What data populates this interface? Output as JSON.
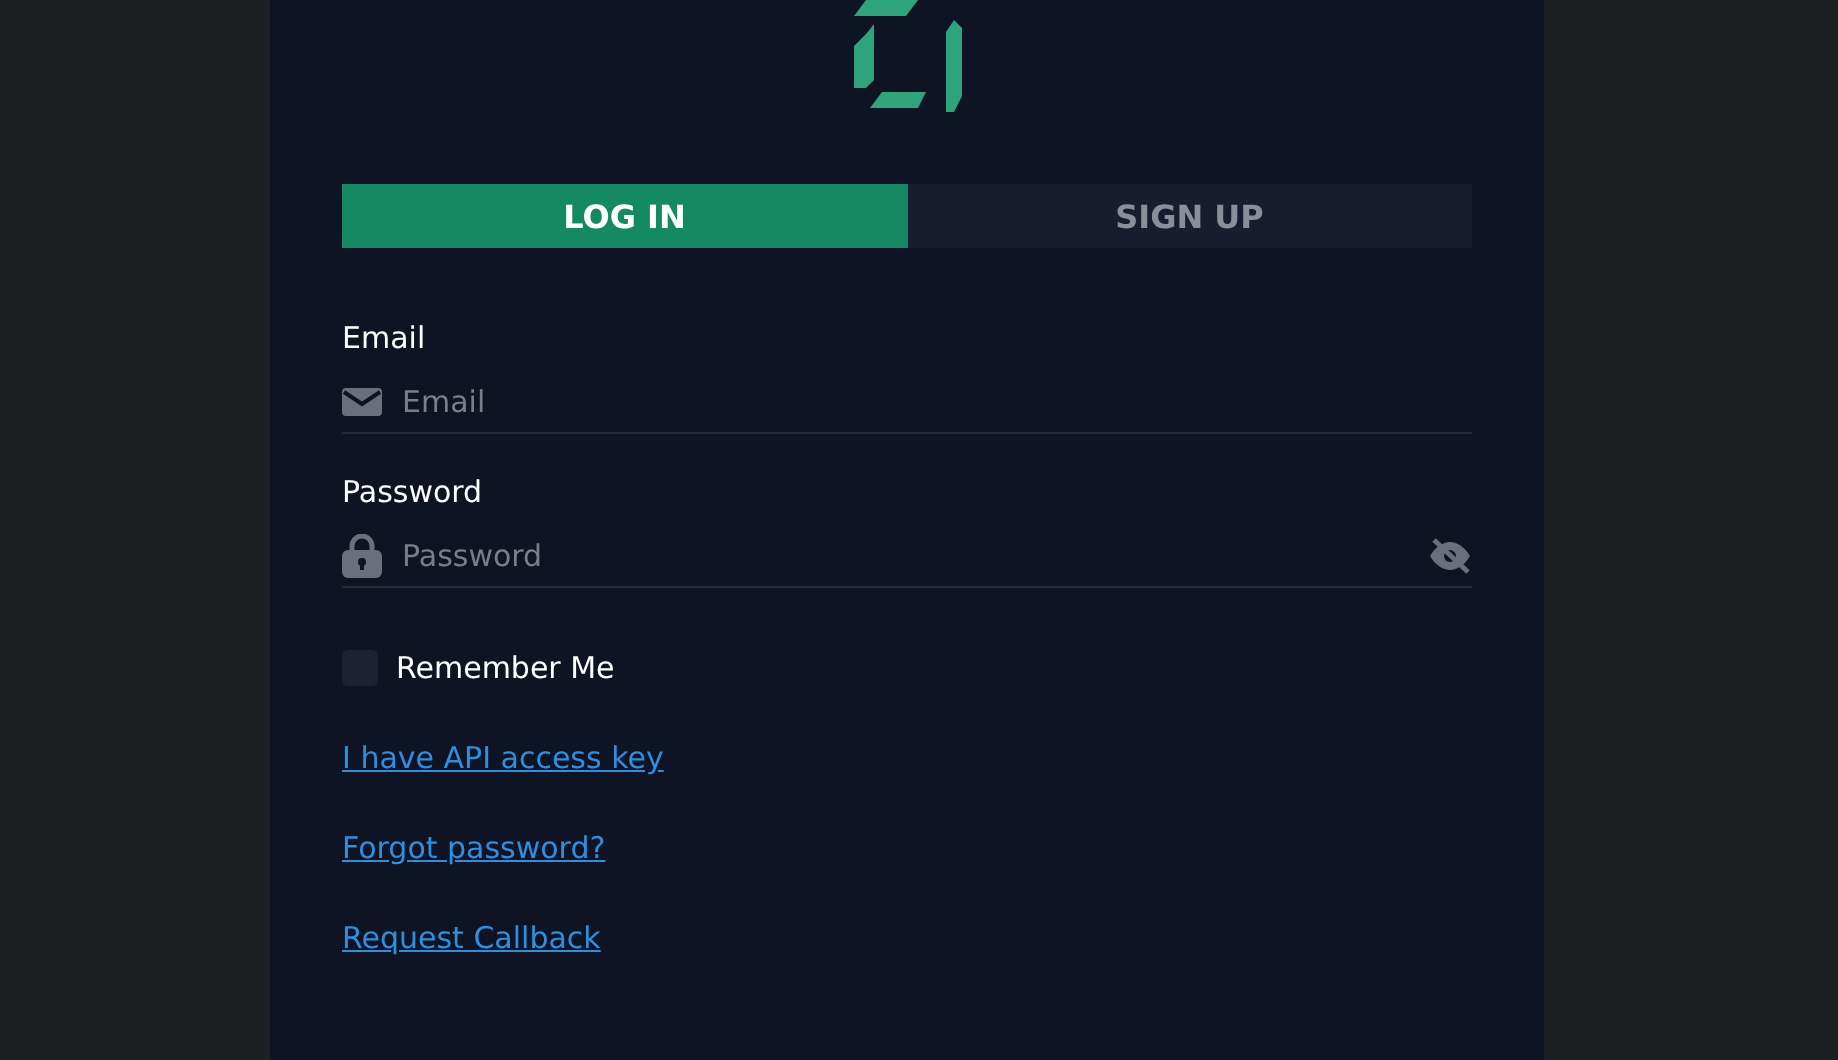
{
  "tabs": [
    {
      "label": "LOG IN",
      "selected": true
    },
    {
      "label": "SIGN UP",
      "selected": false
    }
  ],
  "fields": [
    {
      "kind": "email",
      "label": "Email",
      "placeholder": "Email"
    },
    {
      "kind": "password",
      "label": "Password",
      "placeholder": "Password"
    }
  ],
  "remember": {
    "label": "Remember Me",
    "checked": false
  },
  "links": [
    "I have API access key",
    "Forgot password?",
    "Request Callback"
  ]
}
